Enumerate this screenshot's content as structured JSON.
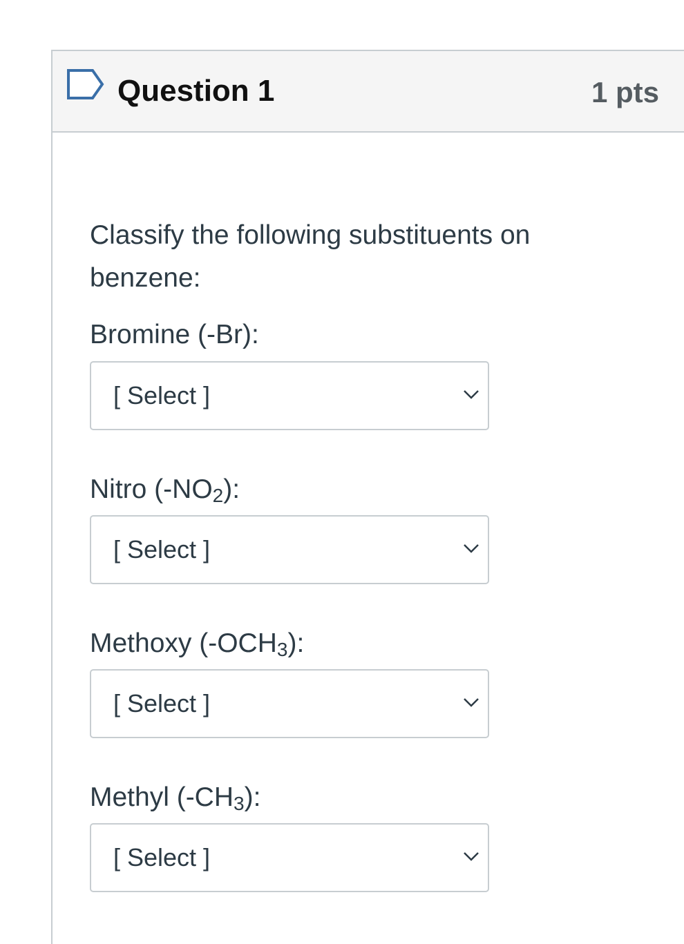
{
  "question": {
    "title": "Question 1",
    "points": "1 pts",
    "prompt": "Classify the following substituents on benzene:"
  },
  "items": [
    {
      "label_main": "Bromine (-Br):",
      "label_pre": "",
      "label_sub": "",
      "label_post": "",
      "selected": "[ Select ]"
    },
    {
      "label_main": "",
      "label_pre": "Nitro (-NO",
      "label_sub": "2",
      "label_post": "):",
      "selected": "[ Select ]"
    },
    {
      "label_main": "",
      "label_pre": "Methoxy (-OCH",
      "label_sub": "3",
      "label_post": "):",
      "selected": "[ Select ]"
    },
    {
      "label_main": "",
      "label_pre": "Methyl (-CH",
      "label_sub": "3",
      "label_post": "):",
      "selected": "[ Select ]"
    }
  ],
  "icons": {
    "flag": "flag-question-icon",
    "chevron": "chevron-down-icon"
  },
  "colors": {
    "header_bg": "#f5f5f5",
    "border": "#c7cdd1",
    "text": "#2d3b45"
  }
}
